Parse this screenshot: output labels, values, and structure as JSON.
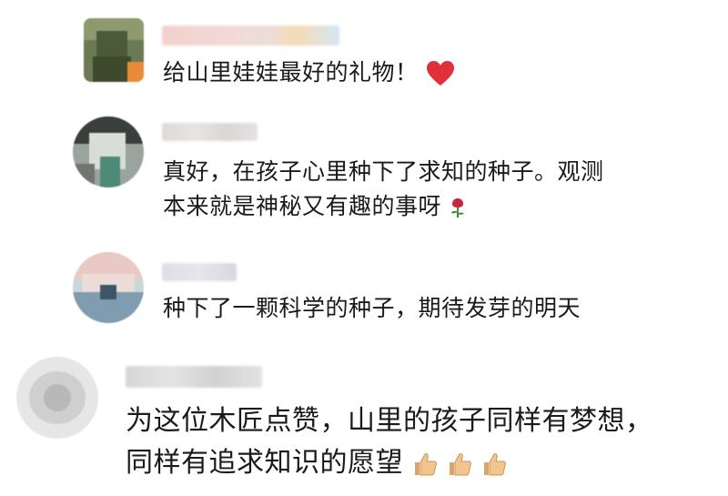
{
  "comments": [
    {
      "text_lines": [
        "给山里娃娃最好的礼物！"
      ],
      "emoji": "heart-icon"
    },
    {
      "text_lines": [
        "真好，在孩子心里种下了求知的种子。观测",
        "本来就是神秘又有趣的事呀"
      ],
      "emoji": "rose-icon"
    },
    {
      "text_lines": [
        "种下了一颗科学的种子，期待发芽的明天"
      ],
      "emoji": ""
    },
    {
      "text_lines": [
        "为这位木匠点赞，山里的孩子同样有梦想，",
        "同样有追求知识的愿望"
      ],
      "emoji": "thumbs-up-icon"
    }
  ],
  "colors": {
    "heart": "#e0303a",
    "rose": "#c8283a",
    "thumb": "#f2c58c",
    "name_blur_light": "#eadfdf"
  }
}
